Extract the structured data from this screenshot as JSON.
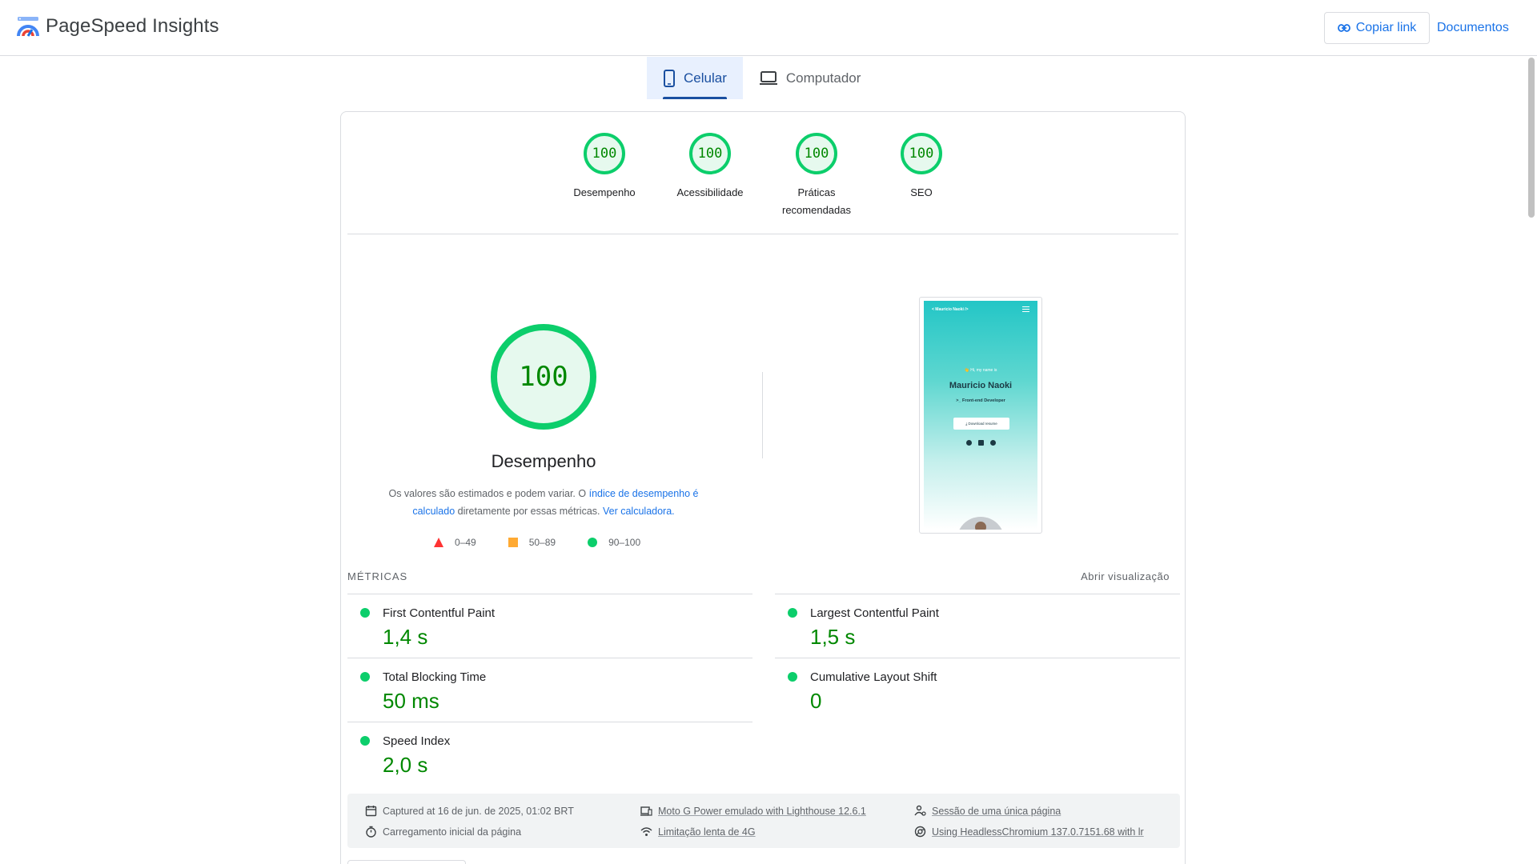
{
  "header": {
    "app_title": "PageSpeed Insights",
    "copy_link_label": "Copiar link",
    "docs_label": "Documentos"
  },
  "tabs": [
    {
      "label": "Celular",
      "active": true,
      "icon": "smartphone-icon"
    },
    {
      "label": "Computador",
      "active": false,
      "icon": "laptop-icon"
    }
  ],
  "scores": [
    {
      "value": "100",
      "label": "Desempenho"
    },
    {
      "value": "100",
      "label": "Acessibilidade"
    },
    {
      "value": "100",
      "label": "Práticas recomendadas"
    },
    {
      "value": "100",
      "label": "SEO"
    }
  ],
  "performance": {
    "score": "100",
    "title": "Desempenho",
    "desc_prefix": "Os valores são estimados e podem variar. O",
    "desc_link1": "índice de desempenho é calculado",
    "desc_middle": "diretamente por essas métricas.",
    "desc_link2": "Ver calculadora."
  },
  "legend": [
    {
      "range": "0–49",
      "shape": "triangle",
      "color": "#ff3333"
    },
    {
      "range": "50–89",
      "shape": "square",
      "color": "#ffaa33"
    },
    {
      "range": "90–100",
      "shape": "circle",
      "color": "#0cce6b"
    }
  ],
  "screenshot": {
    "nav": "< Mauricio Naoki />",
    "hi": "👋 Hi, my name is",
    "name": "Mauricio Naoki",
    "role": ">_ Front-end Developer",
    "button": "⤓ Download resume"
  },
  "metrics": {
    "header": "MÉTRICAS",
    "expand": "Abrir visualização",
    "items": [
      {
        "name": "First Contentful Paint",
        "value": "1,4 s"
      },
      {
        "name": "Largest Contentful Paint",
        "value": "1,5 s"
      },
      {
        "name": "Total Blocking Time",
        "value": "50 ms"
      },
      {
        "name": "Cumulative Layout Shift",
        "value": "0"
      },
      {
        "name": "Speed Index",
        "value": "2,0 s"
      }
    ]
  },
  "runtime": {
    "captured": "Captured at 16 de jun. de 2025, 01:02 BRT",
    "load": "Carregamento inicial da página",
    "device": "Moto G Power emulado with Lighthouse 12.6.1",
    "throttle": "Limitação lenta de 4G",
    "session": "Sessão de uma única página",
    "browser": "Using HeadlessChromium 137.0.7151.68 with lr"
  },
  "colors": {
    "pass": "#0cce6b",
    "pass_text": "#008800",
    "accent": "#1a73e8"
  }
}
